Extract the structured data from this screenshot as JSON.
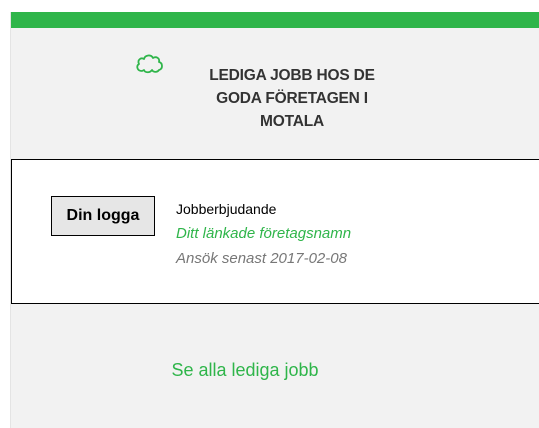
{
  "widget": {
    "title_lines": [
      "LEDIGA JOBB HOS DE",
      "GODA FÖRETAGEN I",
      "MOTALA"
    ],
    "icon": "cloud-icon",
    "accent_color": "#2fb54a"
  },
  "job": {
    "logo_label": "Din logga",
    "title": "Jobberbjudande",
    "company": "Ditt länkade företagsnamn",
    "deadline": "Ansök senast 2017-02-08"
  },
  "footer": {
    "all_jobs_label": "Se alla lediga jobb"
  }
}
